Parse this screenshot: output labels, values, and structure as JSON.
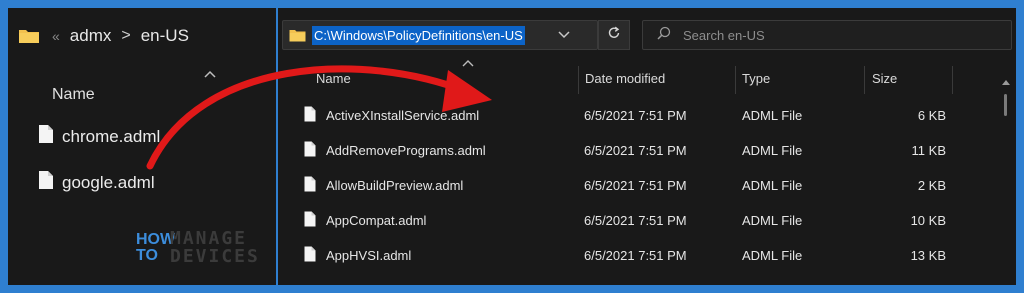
{
  "left_pane": {
    "breadcrumb": {
      "chevrons": "«",
      "parent": "admx",
      "separator": ">",
      "current": "en-US"
    },
    "name_header": "Name",
    "files": [
      "chrome.adml",
      "google.adml"
    ]
  },
  "watermark": {
    "line1": "HOW",
    "line2": "TO",
    "word1": "MANAGE",
    "word2": "DEVICES"
  },
  "address_bar": {
    "path": "C:\\Windows\\PolicyDefinitions\\en-US"
  },
  "search": {
    "placeholder": "Search en-US"
  },
  "columns": {
    "name": "Name",
    "date": "Date modified",
    "type": "Type",
    "size": "Size"
  },
  "files": [
    {
      "name": "ActiveXInstallService.adml",
      "date": "6/5/2021 7:51 PM",
      "type": "ADML File",
      "size": "6 KB"
    },
    {
      "name": "AddRemovePrograms.adml",
      "date": "6/5/2021 7:51 PM",
      "type": "ADML File",
      "size": "11 KB"
    },
    {
      "name": "AllowBuildPreview.adml",
      "date": "6/5/2021 7:51 PM",
      "type": "ADML File",
      "size": "2 KB"
    },
    {
      "name": "AppCompat.adml",
      "date": "6/5/2021 7:51 PM",
      "type": "ADML File",
      "size": "10 KB"
    },
    {
      "name": "AppHVSI.adml",
      "date": "6/5/2021 7:51 PM",
      "type": "ADML File",
      "size": "13 KB"
    }
  ],
  "colors": {
    "frame": "#2f7fd0",
    "pane": "#191919",
    "selection": "#0c63c7",
    "arrow": "#e01919",
    "folder": "#f2c14e"
  },
  "icons": {
    "folder": "folder-icon",
    "document": "document-icon",
    "search": "search-icon",
    "refresh": "refresh-icon",
    "dropdown": "chevron-down-icon",
    "sort": "sort-up-icon"
  }
}
